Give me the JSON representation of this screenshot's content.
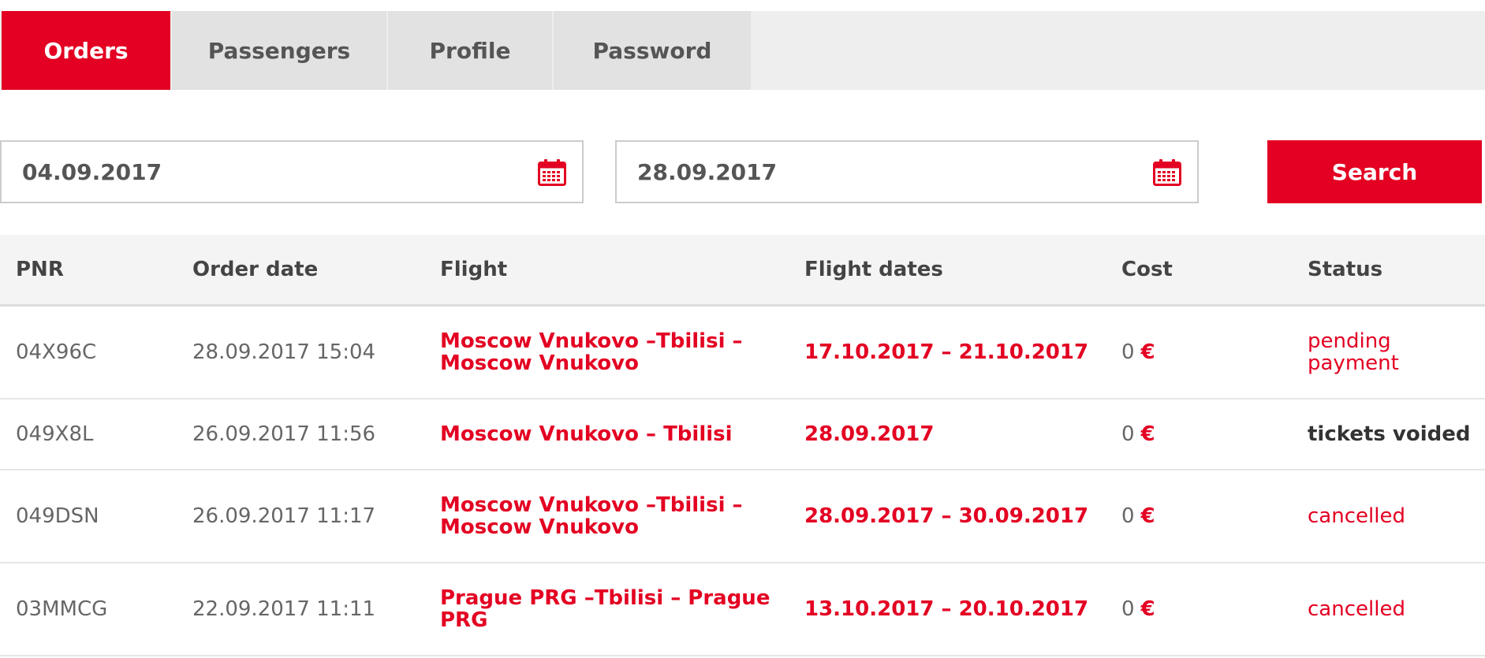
{
  "tabs": [
    {
      "label": "Orders",
      "active": true
    },
    {
      "label": "Passengers",
      "active": false
    },
    {
      "label": "Profile",
      "active": false
    },
    {
      "label": "Password",
      "active": false
    }
  ],
  "filters": {
    "date_from": "04.09.2017",
    "date_to": "28.09.2017",
    "calendar_icon": "calendar-icon",
    "search_label": "Search"
  },
  "table": {
    "headers": [
      "PNR",
      "Order date",
      "Flight",
      "Flight dates",
      "Cost",
      "Status"
    ],
    "rows": [
      {
        "pnr": "04X96C",
        "order_date": "28.09.2017 15:04",
        "flight": "Moscow  Vnukovo –Tbilisi  – Moscow  Vnukovo",
        "flight_dates": "17.10.2017 – 21.10.2017",
        "cost": "0",
        "currency": "€",
        "status": "pending payment"
      },
      {
        "pnr": "049X8L",
        "order_date": "26.09.2017 11:56",
        "flight": "Moscow  Vnukovo – Tbilisi",
        "flight_dates": "28.09.2017",
        "cost": "0",
        "currency": "€",
        "status": "tickets voided"
      },
      {
        "pnr": "049DSN",
        "order_date": "26.09.2017 11:17",
        "flight": "Moscow  Vnukovo –Tbilisi  – Moscow  Vnukovo",
        "flight_dates": "28.09.2017 – 30.09.2017",
        "cost": "0",
        "currency": "€",
        "status": "cancelled"
      },
      {
        "pnr": "03MMCG",
        "order_date": "22.09.2017 11:11",
        "flight": "Prague  PRG –Tbilisi  – Prague  PRG",
        "flight_dates": "13.10.2017 – 20.10.2017",
        "cost": "0",
        "currency": "€",
        "status": "cancelled"
      }
    ]
  },
  "colors": {
    "accent": "#e30022",
    "tab_inactive": "#e2e2e2",
    "tabbar_bg": "#eeeeee",
    "header_bg": "#f4f4f4",
    "status_voided": "#333333"
  }
}
